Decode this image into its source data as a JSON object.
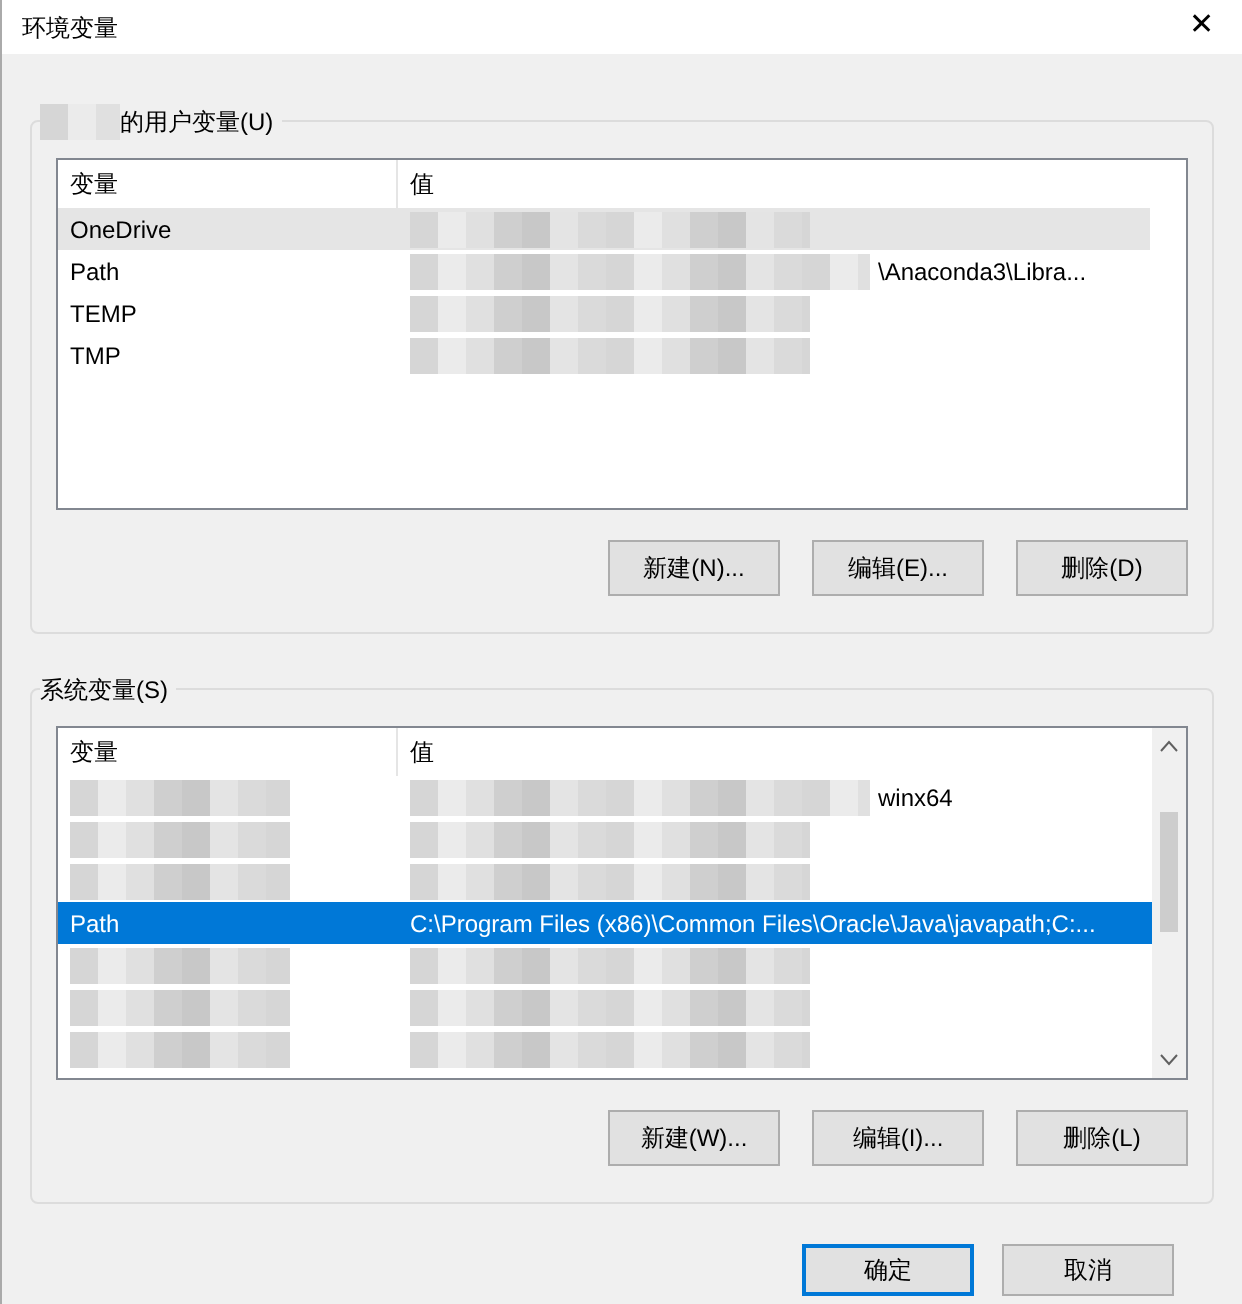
{
  "window": {
    "title": "环境变量",
    "close": "✕"
  },
  "user_group": {
    "label": "的用户变量(U)",
    "columns": [
      "变量",
      "值"
    ],
    "rows": [
      {
        "kind": "masked_value",
        "name": "OneDrive",
        "selected": false,
        "highlighted": true
      },
      {
        "kind": "masked_value",
        "name": "Path",
        "selected": false,
        "highlighted": false,
        "value": "\\Anaconda3\\Libra..."
      },
      {
        "kind": "masked_value",
        "name": "TEMP",
        "selected": false,
        "highlighted": false
      },
      {
        "kind": "masked_value",
        "name": "TMP",
        "selected": false,
        "highlighted": false
      }
    ],
    "buttons": [
      "新建(N)...",
      "编辑(E)...",
      "删除(D)"
    ]
  },
  "system_group": {
    "label": "系统变量(S)",
    "columns": [
      "变量",
      "值"
    ],
    "rows": [
      {
        "kind": "masked",
        "selected": false,
        "highlighted": false,
        "value": "winx64"
      },
      {
        "kind": "masked",
        "selected": false,
        "highlighted": false
      },
      {
        "kind": "masked",
        "selected": false,
        "highlighted": false
      },
      {
        "kind": "plain",
        "name": "Path",
        "selected": true,
        "highlighted": false,
        "value": "C:\\Program Files (x86)\\Common Files\\Oracle\\Java\\javapath;C:..."
      },
      {
        "kind": "masked",
        "selected": false,
        "highlighted": false
      },
      {
        "kind": "masked",
        "selected": false,
        "highlighted": false
      },
      {
        "kind": "masked",
        "selected": false,
        "highlighted": false
      }
    ],
    "buttons": [
      "新建(W)...",
      "编辑(I)...",
      "删除(L)"
    ]
  },
  "footer": {
    "ok": "确定",
    "cancel": "取消"
  }
}
